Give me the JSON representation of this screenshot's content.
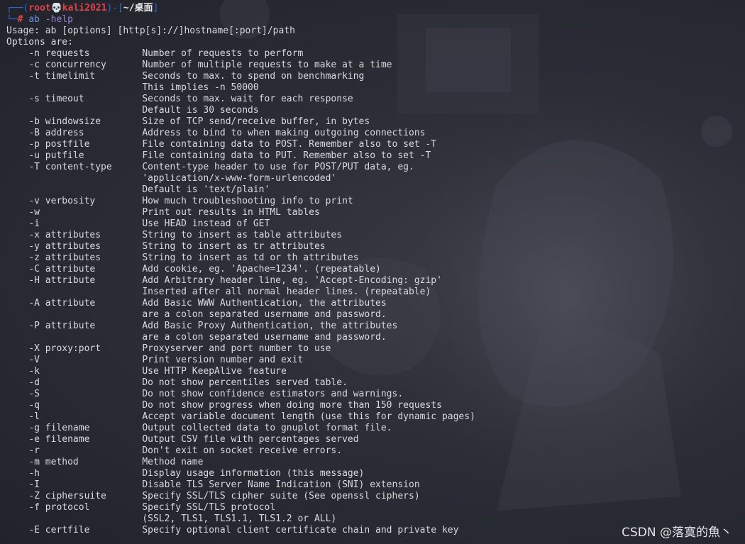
{
  "prompt": {
    "open": "┌──(",
    "userhost": "root💀kali2021",
    "close": ")-[",
    "cwd": "~/桌面",
    "end": "]",
    "second_prefix": "└─",
    "hash": "#",
    "command": "ab",
    "command_arg": "-help"
  },
  "usage": "Usage: ab [options] [http[s]://]hostname[:port]/path",
  "options_header": "Options are:",
  "options": [
    {
      "flag": "-n requests",
      "desc": "Number of requests to perform"
    },
    {
      "flag": "-c concurrency",
      "desc": "Number of multiple requests to make at a time"
    },
    {
      "flag": "-t timelimit",
      "desc": "Seconds to max. to spend on benchmarking"
    },
    {
      "flag": "",
      "desc": "This implies -n 50000"
    },
    {
      "flag": "-s timeout",
      "desc": "Seconds to max. wait for each response"
    },
    {
      "flag": "",
      "desc": "Default is 30 seconds"
    },
    {
      "flag": "-b windowsize",
      "desc": "Size of TCP send/receive buffer, in bytes"
    },
    {
      "flag": "-B address",
      "desc": "Address to bind to when making outgoing connections"
    },
    {
      "flag": "-p postfile",
      "desc": "File containing data to POST. Remember also to set -T"
    },
    {
      "flag": "-u putfile",
      "desc": "File containing data to PUT. Remember also to set -T"
    },
    {
      "flag": "-T content-type",
      "desc": "Content-type header to use for POST/PUT data, eg."
    },
    {
      "flag": "",
      "desc": "'application/x-www-form-urlencoded'"
    },
    {
      "flag": "",
      "desc": "Default is 'text/plain'"
    },
    {
      "flag": "-v verbosity",
      "desc": "How much troubleshooting info to print"
    },
    {
      "flag": "-w",
      "desc": "Print out results in HTML tables"
    },
    {
      "flag": "-i",
      "desc": "Use HEAD instead of GET"
    },
    {
      "flag": "-x attributes",
      "desc": "String to insert as table attributes"
    },
    {
      "flag": "-y attributes",
      "desc": "String to insert as tr attributes"
    },
    {
      "flag": "-z attributes",
      "desc": "String to insert as td or th attributes"
    },
    {
      "flag": "-C attribute",
      "desc": "Add cookie, eg. 'Apache=1234'. (repeatable)"
    },
    {
      "flag": "-H attribute",
      "desc": "Add Arbitrary header line, eg. 'Accept-Encoding: gzip'"
    },
    {
      "flag": "",
      "desc": "Inserted after all normal header lines. (repeatable)"
    },
    {
      "flag": "-A attribute",
      "desc": "Add Basic WWW Authentication, the attributes"
    },
    {
      "flag": "",
      "desc": "are a colon separated username and password."
    },
    {
      "flag": "-P attribute",
      "desc": "Add Basic Proxy Authentication, the attributes"
    },
    {
      "flag": "",
      "desc": "are a colon separated username and password."
    },
    {
      "flag": "-X proxy:port",
      "desc": "Proxyserver and port number to use"
    },
    {
      "flag": "-V",
      "desc": "Print version number and exit"
    },
    {
      "flag": "-k",
      "desc": "Use HTTP KeepAlive feature"
    },
    {
      "flag": "-d",
      "desc": "Do not show percentiles served table."
    },
    {
      "flag": "-S",
      "desc": "Do not show confidence estimators and warnings."
    },
    {
      "flag": "-q",
      "desc": "Do not show progress when doing more than 150 requests"
    },
    {
      "flag": "-l",
      "desc": "Accept variable document length (use this for dynamic pages)"
    },
    {
      "flag": "-g filename",
      "desc": "Output collected data to gnuplot format file."
    },
    {
      "flag": "-e filename",
      "desc": "Output CSV file with percentages served"
    },
    {
      "flag": "-r",
      "desc": "Don't exit on socket receive errors."
    },
    {
      "flag": "-m method",
      "desc": "Method name"
    },
    {
      "flag": "-h",
      "desc": "Display usage information (this message)"
    },
    {
      "flag": "-I",
      "desc": "Disable TLS Server Name Indication (SNI) extension"
    },
    {
      "flag": "-Z ciphersuite",
      "desc": "Specify SSL/TLS cipher suite (See openssl ciphers)"
    },
    {
      "flag": "-f protocol",
      "desc": "Specify SSL/TLS protocol"
    },
    {
      "flag": "",
      "desc": "(SSL2, TLS1, TLS1.1, TLS1.2 or ALL)"
    },
    {
      "flag": "-E certfile",
      "desc": "Specify optional client certificate chain and private key"
    }
  ],
  "watermark": "CSDN @落寞的魚丶"
}
